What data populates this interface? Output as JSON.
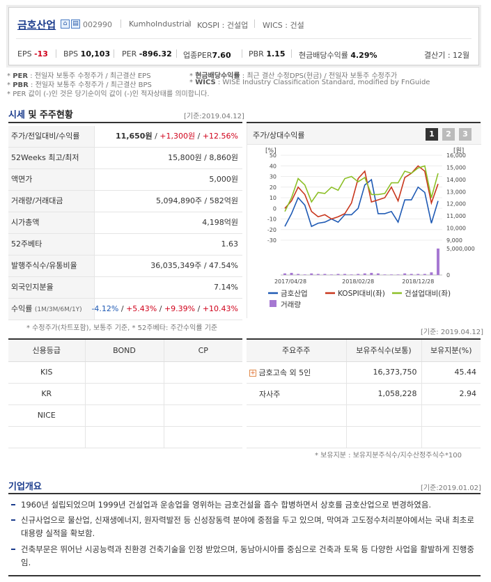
{
  "company": {
    "name": "금호산업",
    "code": "002990",
    "name_en": "KumhoIndustrial",
    "market": "KOSPI : 건설업",
    "wics": "WICS : 건설",
    "icons": [
      "home-icon",
      "report-icon"
    ]
  },
  "stats": {
    "eps_label": "EPS",
    "eps": "-13",
    "bps_label": "BPS",
    "bps": "10,103",
    "per_label": "PER",
    "per": "-896.32",
    "ind_per_label": "업종PER",
    "ind_per": "7.60",
    "pbr_label": "PBR",
    "pbr": "1.15",
    "div_label": "현금배당수익률",
    "div": "4.29%",
    "fiscal": "결산기 : 12월"
  },
  "notes": {
    "per_key": "PER",
    "per_text": ": 전일자 보통주 수정주가 / 최근결산 EPS",
    "pbr_key": "PBR",
    "pbr_text": ": 전일자 보통주 수정주가 / 최근결산 BPS",
    "div_key": "현금배당수익률",
    "div_text": ": 최근 결산 수정DPS(현금) / 전일자 보통주 수정주가",
    "wics_key": "WICS",
    "wics_text": ": WISE Industry Classification Standard, modified by FnGuide",
    "neg_note": "PER 값이 (-)인 것은 당기순이익 값이 (-)인 적자상태를 의미합니다."
  },
  "market_section": {
    "title_hl": "시세",
    "title_rest": " 및 주주현황",
    "date": "[기준:2019.04.12]",
    "rows": [
      {
        "label": "주가/전일대비/수익률",
        "v1": "11,650원",
        "v2": "+1,300원",
        "v3": "+12.56%"
      },
      {
        "label": "52Weeks 최고/최저",
        "value": "15,800원 / 8,860원"
      },
      {
        "label": "액면가",
        "value": "5,000원"
      },
      {
        "label": "거래량/거래대금",
        "value": "5,094,890주 / 582억원"
      },
      {
        "label": "시가총액",
        "value": "4,198억원"
      },
      {
        "label": "52주베타",
        "value": "1.63"
      },
      {
        "label": "발행주식수/유통비율",
        "value": "36,035,349주 / 47.54%"
      },
      {
        "label": "외국인지분율",
        "value": "7.14%"
      },
      {
        "label": "수익률",
        "label_sub": "(1M/3M/6M/1Y)",
        "r1": "-4.12%",
        "r2": "+5.43%",
        "r3": "+9.39%",
        "r4": "+10.43%"
      }
    ],
    "footnote": "* 수정주가(차트포함), 보통주 기준, * 52주베타: 주간수익률 기준"
  },
  "chart_panel": {
    "title": "주가/상대수익률",
    "pages": [
      "1",
      "2",
      "3"
    ],
    "active_page": "1"
  },
  "chart_data": {
    "type": "line",
    "left_unit": "[%]",
    "right_unit": "[원]",
    "left_ticks": [
      "50",
      "40",
      "30",
      "20",
      "10",
      "0",
      "-10",
      "-20",
      "-30"
    ],
    "right_ticks": [
      "16,000",
      "15,000",
      "14,000",
      "13,000",
      "12,000",
      "11,000",
      "10,000",
      "9,000"
    ],
    "volume_ticks": [
      "5,000,000",
      "0"
    ],
    "x_labels": [
      "2017/04/28",
      "2018/02/28",
      "2018/12/28"
    ],
    "ylim_left": [
      -30,
      50
    ],
    "ylim_right": [
      9000,
      16000
    ],
    "series": [
      {
        "name": "금호산업",
        "color": "#1f5ab4",
        "values": [
          -17,
          -5,
          10,
          3,
          -17,
          -14,
          -13,
          -10,
          -13,
          -6,
          -6,
          0,
          22,
          27,
          -5,
          -5,
          -3,
          -13,
          8,
          8,
          20,
          15,
          -14,
          7
        ]
      },
      {
        "name": "KOSPI대비(좌)",
        "color": "#c8361c",
        "values": [
          0,
          7,
          20,
          13,
          -3,
          -8,
          -6,
          -10,
          -8,
          -5,
          5,
          28,
          35,
          6,
          8,
          10,
          20,
          7,
          29,
          33,
          40,
          35,
          5,
          23
        ]
      },
      {
        "name": "건설업대비(좌)",
        "color": "#8cbf26",
        "values": [
          -3,
          10,
          28,
          22,
          6,
          15,
          14,
          20,
          17,
          28,
          30,
          25,
          29,
          13,
          13,
          14,
          24,
          24,
          35,
          33,
          38,
          40,
          10,
          33
        ]
      }
    ],
    "volume": {
      "name": "거래량",
      "color": "#a678d2",
      "values": [
        0.3,
        0.4,
        0.2,
        0.1,
        0.3,
        0.2,
        0.2,
        0.1,
        0.2,
        0.2,
        0.1,
        0.2,
        0.3,
        0.4,
        0.3,
        0.1,
        0.1,
        0.1,
        0.3,
        0.2,
        0.2,
        0.2,
        0.5,
        5.0
      ]
    }
  },
  "credit": {
    "headers": [
      "신용등급",
      "BOND",
      "CP"
    ],
    "rows": [
      [
        "KIS",
        "",
        ""
      ],
      [
        "KR",
        "",
        ""
      ],
      [
        "NICE",
        "",
        ""
      ]
    ]
  },
  "holders": {
    "date": "[기준: 2019.04.12]",
    "headers": [
      "주요주주",
      "보유주식수(보통)",
      "보유지분(%)"
    ],
    "rows": [
      {
        "name": "금호고속 외 5인",
        "shares": "16,373,750",
        "pct": "45.44",
        "expand": "+"
      },
      {
        "name": "자사주",
        "shares": "1,058,228",
        "pct": "2.94"
      }
    ],
    "footnote": "* 보유지분 : 보유지분주식수/지수산정주식수*100"
  },
  "overview": {
    "title": "기업개요",
    "date": "[기준:2019.01.02]",
    "items": [
      "1960년 설립되었으며 1999년 건설업과 운송업을 영위하는 금호건설을 흡수 합병하면서 상호를 금호산업으로 변경하였음.",
      "신규사업으로 물산업, 신재생에너지, 원자력발전 등 신성장동력 분야에 중점을 두고 있으며, 막여과 고도정수처리분야에서는 국내 최초로 대용량 실적을 확보함.",
      "건축부문은 뛰어난 시공능력과 친환경 건축기술을 인정 받았으며, 동남아시아를 중심으로 건축과 토목 등 다양한 사업을 활발하게 진행중임."
    ]
  }
}
